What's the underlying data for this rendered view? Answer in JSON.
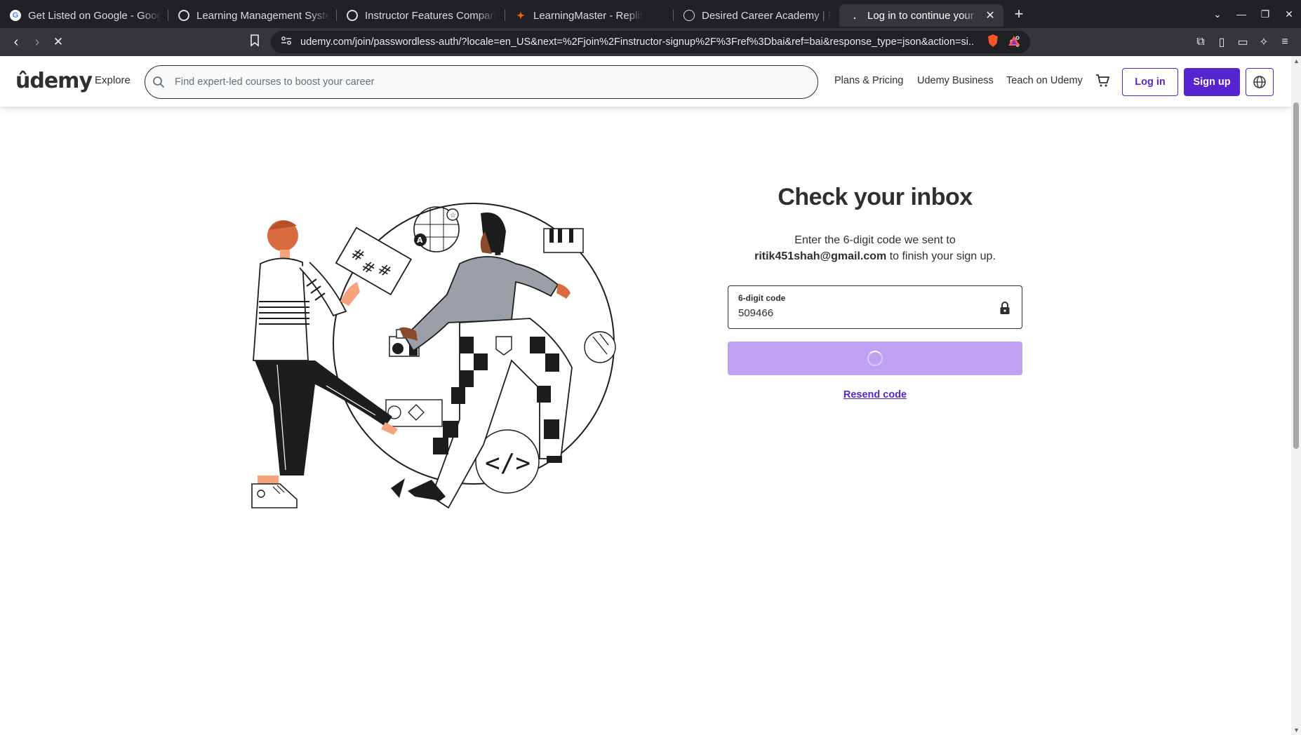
{
  "browser": {
    "tabs": [
      {
        "title": "Get Listed on Google - Goog",
        "icon": "google-icon"
      },
      {
        "title": "Learning Management Syste",
        "icon": "openai-icon"
      },
      {
        "title": "Instructor Features Compari",
        "icon": "openai-icon"
      },
      {
        "title": "LearningMaster - Replit",
        "icon": "replit-icon"
      },
      {
        "title": "Desired Career Academy | Er",
        "icon": "globe-icon"
      },
      {
        "title": "Log in to continue your l",
        "icon": "loading-icon",
        "active": true
      }
    ],
    "url": "udemy.com/join/passwordless-auth/?locale=en_US&next=%2Fjoin%2Finstructor-signup%2F%3Fref%3Dbai&ref=bai&response_type=json&action=si..."
  },
  "header": {
    "logo": "ûdemy",
    "explore": "Explore",
    "search_placeholder": "Find expert-led courses to boost your career",
    "links": [
      "Plans & Pricing",
      "Udemy Business",
      "Teach on Udemy"
    ],
    "login": "Log in",
    "signup": "Sign up"
  },
  "main": {
    "title": "Check your inbox",
    "desc_prefix": "Enter the 6-digit code we sent to",
    "email": "ritik451shah@gmail.com",
    "desc_suffix": "to finish your sign up.",
    "code_label": "6-digit code",
    "code_value": "509466",
    "resend": "Resend code"
  },
  "colors": {
    "brand_purple": "#5624d0",
    "button_loading": "#c0a0f2",
    "logo_accent": "#a435f0",
    "chrome_dark": "#202124"
  }
}
